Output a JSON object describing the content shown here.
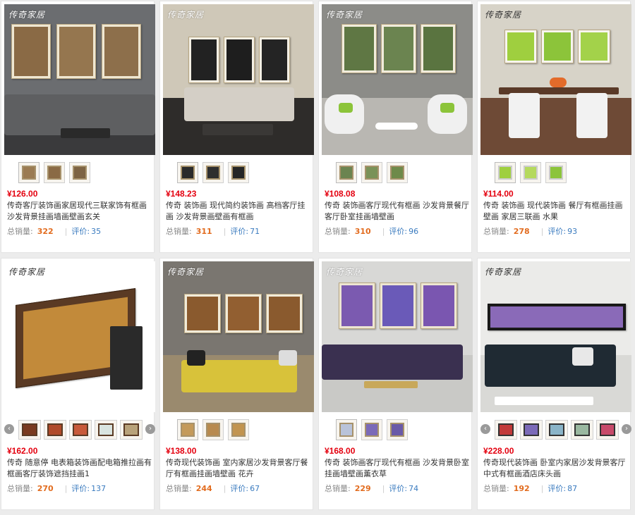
{
  "brand": "传奇家居",
  "sales_label": "总销量:",
  "reviews_label": "评价:",
  "colors": {
    "price": "#e4000f",
    "sales": "#e26c1f",
    "reviews": "#3a7bbf"
  },
  "products": [
    {
      "price": "¥126.00",
      "title": "传奇客厅装饰画家居现代三联家饰有框画沙发背景挂画墙画壁画玄关",
      "sales": "322",
      "reviews": "35"
    },
    {
      "price": "¥148.23",
      "title": "传奇 装饰画 现代简约装饰画 高档客厅挂画 沙发背景画壁画有框画",
      "sales": "311",
      "reviews": "71"
    },
    {
      "price": "¥108.08",
      "title": "传奇 装饰画客厅现代有框画 沙发背景餐厅 客厅卧室挂画墙壁画",
      "sales": "310",
      "reviews": "96"
    },
    {
      "price": "¥114.00",
      "title": "传奇 装饰画 现代装饰画 餐厅有框画挂画壁画 家居三联画 水果",
      "sales": "278",
      "reviews": "93"
    },
    {
      "price": "¥162.00",
      "title": "传奇 随意停 电表箱装饰画配电箱推拉画有框画客厅装饰遮挡挂画1",
      "sales": "270",
      "reviews": "137"
    },
    {
      "price": "¥138.00",
      "title": "传奇现代装饰画 室内家居沙发背景客厅餐厅有框画挂画墙壁画 花卉",
      "sales": "244",
      "reviews": "67"
    },
    {
      "price": "¥168.00",
      "title": "传奇 装饰画客厅现代有框画 沙发背景卧室挂画墙壁画薰衣草",
      "sales": "229",
      "reviews": "74"
    },
    {
      "price": "¥228.00",
      "title": "传奇现代装饰画 卧室内家居沙发背景客厅 中式有框画酒店床头画",
      "sales": "192",
      "reviews": "87"
    }
  ]
}
